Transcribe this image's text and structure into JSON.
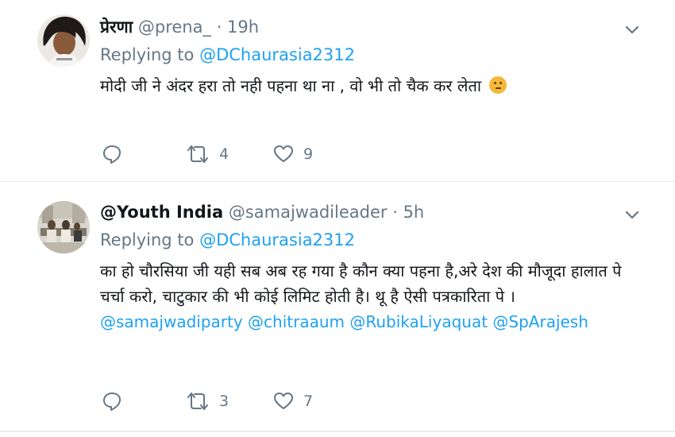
{
  "tweets": [
    {
      "name": "प्रेरणा",
      "handle": "@prena_",
      "separator": "·",
      "time": "19h",
      "replying_prefix": "Replying to",
      "replying_to": "@DChaurasia2312",
      "text": "मोदी जी ने अंदर हरा तो नही पहना था ना , वो भी तो चैक कर लेता",
      "emoji": "thinking-face-emoji",
      "tags": "",
      "reply_count": "",
      "retweet_count": "4",
      "like_count": "9"
    },
    {
      "name": "@Youth India",
      "handle": "@samajwadileader",
      "separator": "·",
      "time": "5h",
      "replying_prefix": "Replying to",
      "replying_to": "@DChaurasia2312",
      "text": "का हो चौरसिया जी यही सब अब रह गया है कौन क्या पहना है,अरे देश की मौजूदा हालात पे चर्चा करो, चाटुकार की भी कोई लिमिट होती है। थू है ऐसी पत्रकारिता पे ।",
      "tags": "@samajwadiparty @chitraaum @RubikaLiyaquat @SpArajesh",
      "reply_count": "",
      "retweet_count": "3",
      "like_count": "7"
    }
  ],
  "icons": {
    "reply": "reply-icon",
    "retweet": "retweet-icon",
    "like": "heart-icon",
    "caret": "chevron-down-icon"
  },
  "colors": {
    "accent": "#1da1f2",
    "secondary_text": "#657786",
    "primary_text": "#14171a",
    "divider": "#e6ecf0"
  }
}
